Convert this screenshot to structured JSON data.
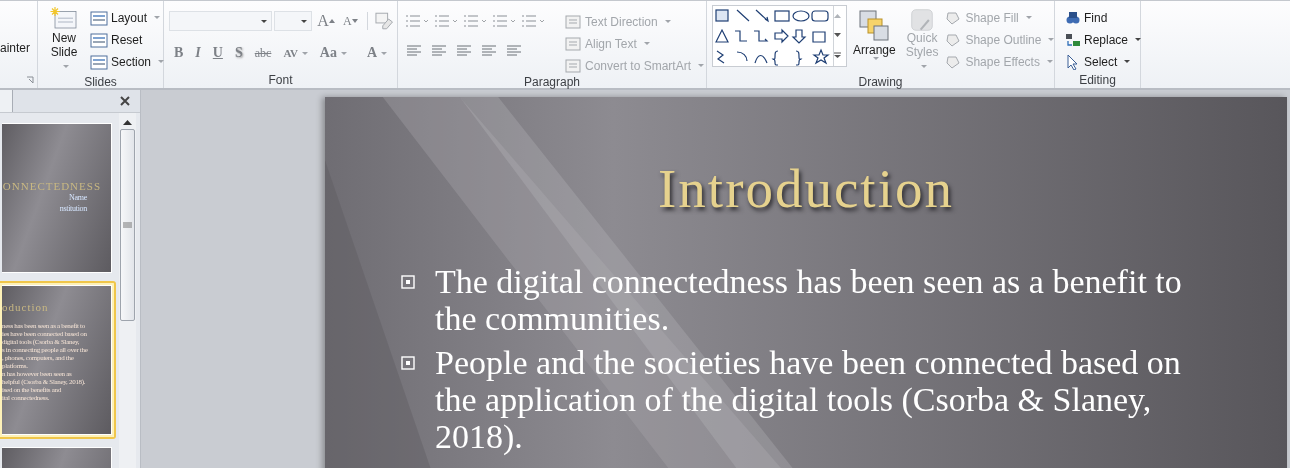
{
  "ribbon": {
    "clipboard": {
      "label": "ainter"
    },
    "slides": {
      "label": "Slides",
      "new_slide": [
        "New",
        "Slide"
      ],
      "items": [
        {
          "label": "Layout",
          "dropdown": true
        },
        {
          "label": "Reset",
          "dropdown": false
        },
        {
          "label": "Section",
          "dropdown": true
        }
      ]
    },
    "font": {
      "label": "Font",
      "grow": "A",
      "shrink": "A",
      "buttons": [
        {
          "label": "B",
          "dropdown": false
        },
        {
          "label": "I",
          "dropdown": false
        },
        {
          "label": "U",
          "dropdown": false
        },
        {
          "label": "S",
          "dropdown": false
        },
        {
          "label": "abc",
          "dropdown": false
        },
        {
          "label": "AV",
          "dropdown": true
        },
        {
          "label": "Aa",
          "dropdown": true
        },
        {
          "label": "A",
          "dropdown": true
        }
      ]
    },
    "paragraph": {
      "label": "Paragraph",
      "items": [
        {
          "label": "Text Direction",
          "disabled": true
        },
        {
          "label": "Align Text",
          "disabled": true
        },
        {
          "label": "Convert to SmartArt",
          "disabled": true
        }
      ]
    },
    "drawing": {
      "label": "Drawing",
      "arrange": "Arrange",
      "quick_styles": [
        "Quick",
        "Styles"
      ],
      "quick_styles_disabled": true,
      "items": [
        {
          "label": "Shape Fill",
          "disabled": true
        },
        {
          "label": "Shape Outline",
          "disabled": true
        },
        {
          "label": "Shape Effects",
          "disabled": true
        }
      ]
    },
    "editing": {
      "label": "Editing",
      "items": [
        {
          "label": "Find",
          "dropdown": false
        },
        {
          "label": "Replace",
          "dropdown": true
        },
        {
          "label": "Select",
          "dropdown": true
        }
      ]
    }
  },
  "slides_pane": {
    "thumbnails": [
      {
        "kind": "title",
        "selected": false,
        "title": "ONNECTEDNESS",
        "lines": [
          "Name",
          "nstitution"
        ]
      },
      {
        "kind": "content",
        "selected": true,
        "title": "oduction",
        "lines": [
          "ness has been seen as a benefit to",
          "ies have been connected based on",
          "digital tools (Csorba & Slaney,",
          "s in connecting people all over the",
          ", phones, computers, and the",
          "platforms.",
          "n has however been seen as",
          "helpful (Csorba & Slaney, 2018).",
          "ised on the benefits and",
          "ital connectedness."
        ]
      },
      {
        "kind": "content",
        "selected": false
      }
    ]
  },
  "slide": {
    "title": "Introduction",
    "bullets": [
      "The digital connectedness has been seen as a benefit to the communities.",
      "People and the societies have been connected based on the application of the digital tools (Csorba & Slaney, 2018)."
    ]
  }
}
